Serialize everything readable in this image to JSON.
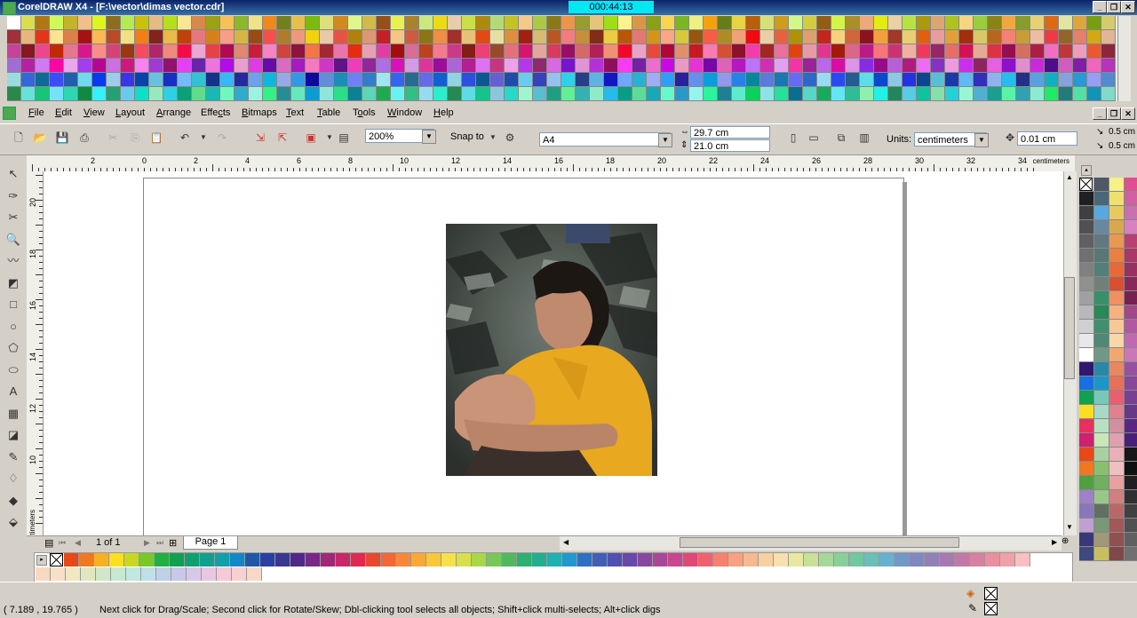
{
  "window": {
    "title": "CorelDRAW X4 - [F:\\vector\\dimas vector.cdr]",
    "timer": "000:44:13"
  },
  "menu": [
    {
      "label": "File",
      "u": "F"
    },
    {
      "label": "Edit",
      "u": "E"
    },
    {
      "label": "View",
      "u": "V"
    },
    {
      "label": "Layout",
      "u": "L"
    },
    {
      "label": "Arrange",
      "u": "A"
    },
    {
      "label": "Effects",
      "u": "c"
    },
    {
      "label": "Bitmaps",
      "u": "B"
    },
    {
      "label": "Text",
      "u": "T"
    },
    {
      "label": "Table",
      "u": "T"
    },
    {
      "label": "Tools",
      "u": "o"
    },
    {
      "label": "Window",
      "u": "W"
    },
    {
      "label": "Help",
      "u": "H"
    }
  ],
  "toolbar": {
    "zoom": "200%",
    "snap_to": "Snap to",
    "paper": "A4",
    "width": "29.7 cm",
    "height": "21.0 cm",
    "units_label": "Units:",
    "units_value": "centimeters",
    "nudge": "0.01 cm",
    "dup_x": "0.5 cm",
    "dup_y": "0.5 cm"
  },
  "ruler": {
    "unit": "centimeters",
    "h_ticks": [
      "2",
      "0",
      "2",
      "4",
      "6",
      "8",
      "10",
      "12",
      "14",
      "16",
      "18",
      "20",
      "22",
      "24",
      "26",
      "28",
      "30",
      "32",
      "34"
    ],
    "v_ticks": [
      "20",
      "18",
      "16",
      "14",
      "12",
      "10"
    ]
  },
  "page_nav": {
    "counter": "1 of 1",
    "tab": "Page 1"
  },
  "status": {
    "coords": "( 7.189 , 19.765 )",
    "hint": "Next click for Drag/Scale; Second click for Rotate/Skew; Dbl-clicking tool selects all objects; Shift+click multi-selects; Alt+click digs"
  },
  "colors": {
    "title_bar": "#0a246a",
    "timer_bg": "#00e8f0",
    "shirt": "#e8a820"
  },
  "icons": {
    "tools": [
      "pick-tool-icon",
      "shape-tool-icon",
      "crop-tool-icon",
      "zoom-tool-icon",
      "freehand-tool-icon",
      "smart-fill-tool-icon",
      "rectangle-tool-icon",
      "ellipse-tool-icon",
      "polygon-tool-icon",
      "basic-shapes-tool-icon",
      "text-tool-icon",
      "table-tool-icon",
      "interactive-blend-tool-icon",
      "eyedropper-tool-icon",
      "outline-tool-icon",
      "fill-tool-icon",
      "interactive-fill-tool-icon"
    ]
  }
}
